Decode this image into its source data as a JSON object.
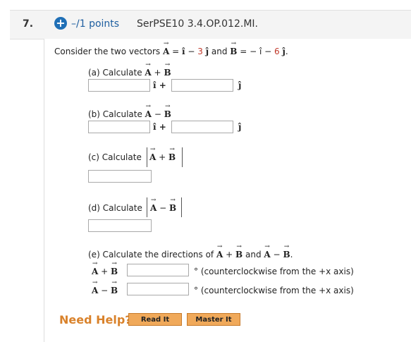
{
  "header": {
    "number": "7.",
    "points": "–/1 points",
    "code": "SerPSE10 3.4.OP.012.MI."
  },
  "question": {
    "intro_pre": "Consider the two vectors",
    "vecA": "A",
    "vecB": "B",
    "eq": " = ",
    "i": "î",
    "j": "ĵ",
    "minus": " − ",
    "num3": "3",
    "num6": "6",
    "and": "and",
    "negA": " − î − ",
    "period": "."
  },
  "parts": {
    "a_label": "(a) Calculate",
    "b_label": "(b) Calculate",
    "c_label": "(c) Calculate",
    "d_label": "(d) Calculate",
    "e_label": "(e) Calculate the directions of",
    "plus": "+",
    "minus": "−",
    "i_plus": "î +",
    "j": "ĵ",
    "and": "and",
    "dot": ".",
    "deg_note": "° (counterclockwise from the +x axis)"
  },
  "footer": {
    "need_help": "Need Help?",
    "read_it": "Read It",
    "master_it": "Master It"
  }
}
